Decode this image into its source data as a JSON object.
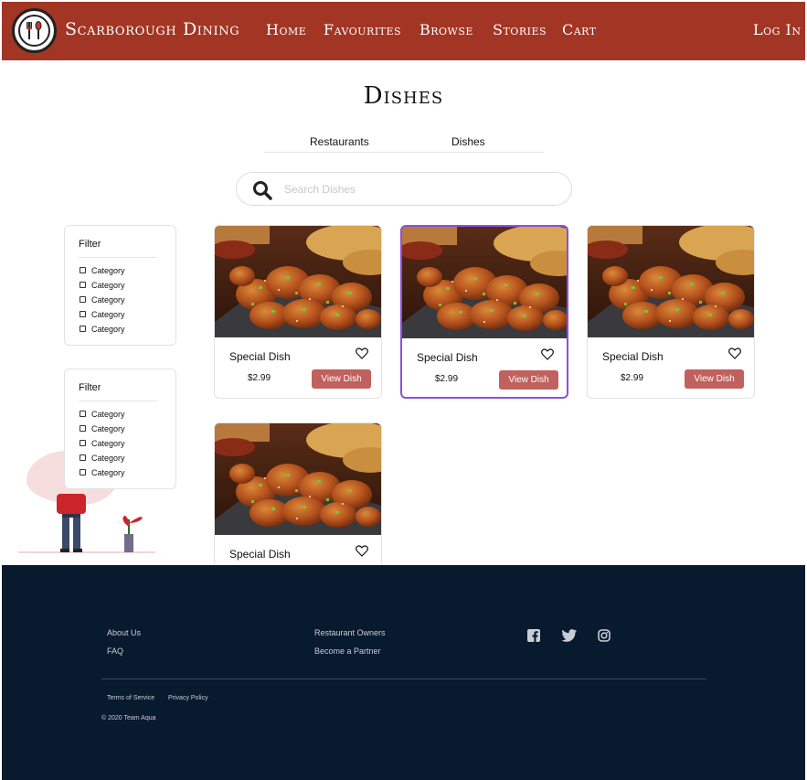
{
  "header": {
    "brand": "Scarborough Dining",
    "nav": [
      "Home",
      "Favourites",
      "Browse",
      "Stories",
      "Cart"
    ],
    "login": "Log In",
    "colors": {
      "bar": "#a23523"
    }
  },
  "page": {
    "title": "Dishes",
    "tabs": [
      "Restaurants",
      "Dishes"
    ]
  },
  "search": {
    "placeholder": "Search Dishes",
    "icon": "search-icon"
  },
  "filters": [
    {
      "title": "Filter",
      "items": [
        "Category",
        "Category",
        "Category",
        "Category",
        "Category"
      ]
    },
    {
      "title": "Filter",
      "items": [
        "Category",
        "Category",
        "Category",
        "Category",
        "Category"
      ]
    }
  ],
  "dishes": [
    {
      "name": "Special Dish",
      "price": "$2.99",
      "button": "View Dish"
    },
    {
      "name": "Special Dish",
      "price": "$2.99",
      "button": "View Dish"
    },
    {
      "name": "Special Dish",
      "price": "$2.99",
      "button": "View Dish"
    },
    {
      "name": "Special Dish"
    }
  ],
  "footer": {
    "links_col1": [
      "About Us",
      "FAQ"
    ],
    "links_col2": [
      "Restaurant Owners",
      "Become a Partner"
    ],
    "legal": [
      "Terms of Service",
      "Privacy Policy"
    ],
    "copyright": "© 2020 Team Aqua",
    "social": [
      "facebook-icon",
      "twitter-icon",
      "instagram-icon"
    ],
    "colors": {
      "background": "#081a2e",
      "button": "#c0615d",
      "selected_border": "#8a4fe0"
    }
  }
}
